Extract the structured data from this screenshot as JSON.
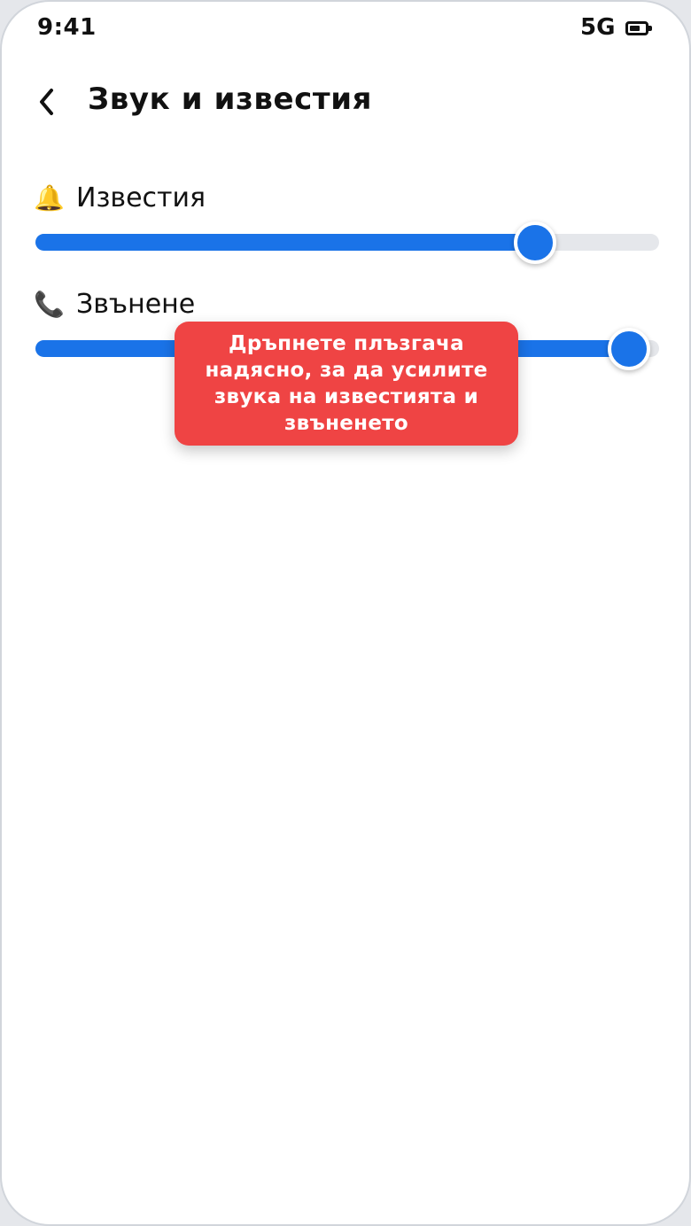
{
  "status_bar": {
    "time": "9:41",
    "network": "5G",
    "battery_icon": "battery-icon"
  },
  "header": {
    "back_icon": "chevron-left-icon",
    "title": "Звук и известия"
  },
  "settings": [
    {
      "icon": "🔔",
      "icon_name": "bell-icon",
      "label": "Известия",
      "level": 0.8
    },
    {
      "icon": "📞",
      "icon_name": "phone-icon",
      "label": "Звънене",
      "level": 0.95
    }
  ],
  "tooltip": {
    "text": "Дръпнете плъзгача надясно, за да усилите звука на известията и звъненето"
  },
  "colors": {
    "accent": "#1a73e8",
    "track": "#e5e7eb",
    "tooltip": "#ef4444"
  }
}
